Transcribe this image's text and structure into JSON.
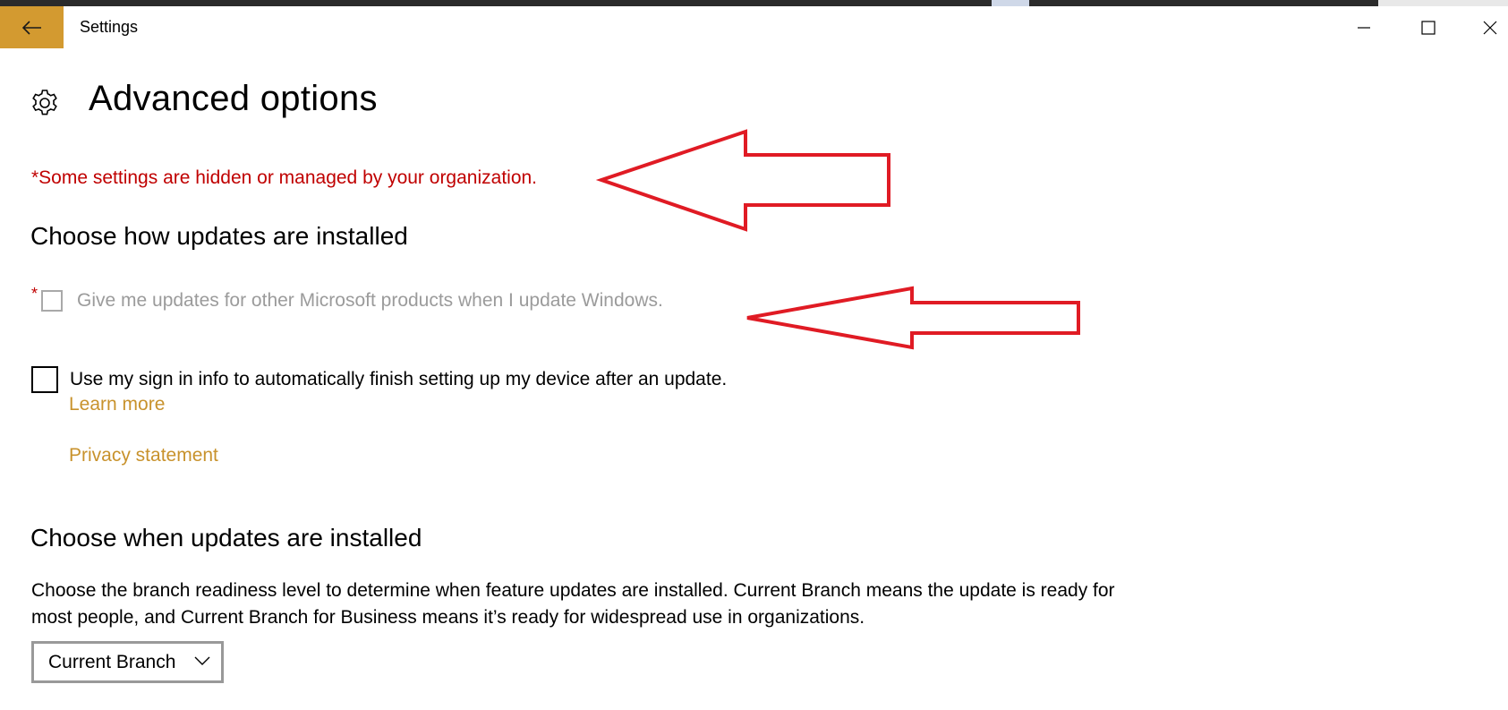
{
  "window": {
    "app_title": "Settings"
  },
  "page": {
    "title": "Advanced options"
  },
  "notice": {
    "text": "*Some settings are hidden or managed by your organization."
  },
  "install_section": {
    "heading": "Choose how updates are installed",
    "option_microsoft_products": {
      "asterisk": "*",
      "label": "Give me updates for other Microsoft products when I update Windows.",
      "checked": false,
      "disabled": true
    },
    "option_sign_in": {
      "label": "Use my sign in info to automatically finish setting up my device after an update.",
      "checked": false,
      "disabled": false
    },
    "learn_more": "Learn more",
    "privacy": "Privacy statement"
  },
  "when_section": {
    "heading": "Choose when updates are installed",
    "description": "Choose the branch readiness level to determine when feature updates are installed. Current Branch means the update is ready for most people, and Current Branch for Business means it’s ready for widespread use in organizations.",
    "branch_select": {
      "value": "Current Branch"
    }
  },
  "icons": [
    "back-arrow-icon",
    "minimize-icon",
    "maximize-icon",
    "close-icon",
    "gear-icon",
    "chevron-down-icon"
  ],
  "colors": {
    "accent": "#d39a30",
    "link": "#c8922c",
    "warning": "#c00000",
    "annotation_arrow": "#e01b24"
  }
}
